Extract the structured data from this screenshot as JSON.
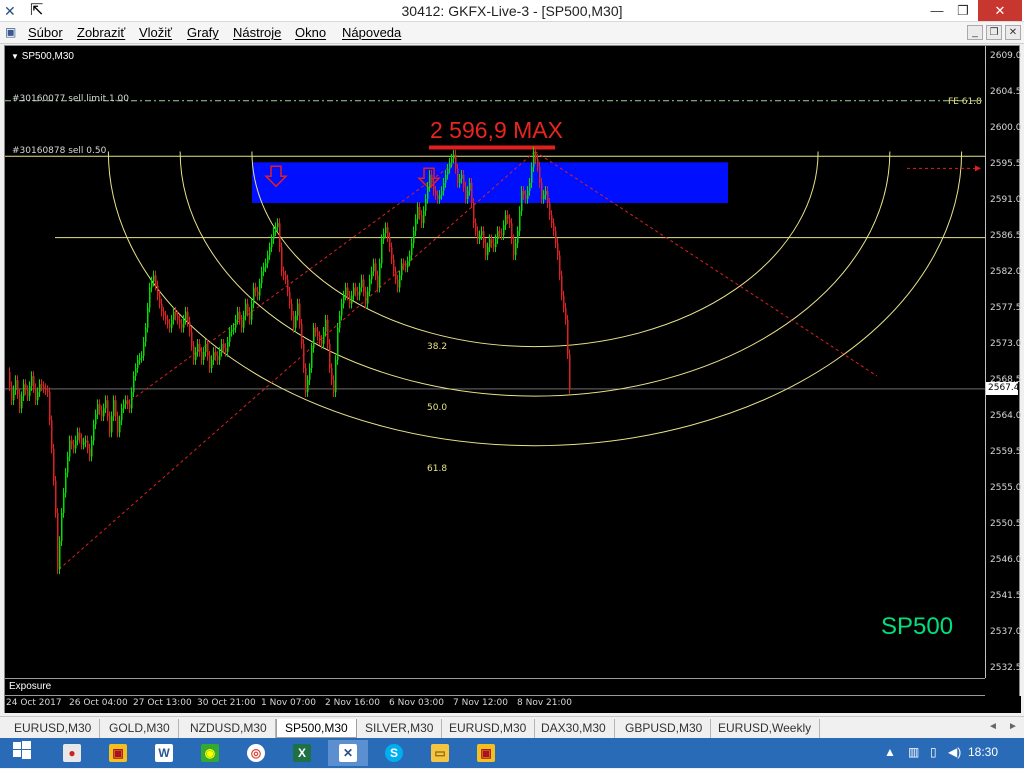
{
  "window": {
    "title": "30412: GKFX-Live-3 - [SP500,M30]",
    "minimize": "—",
    "maximize": "❐",
    "close": "✕"
  },
  "menu": {
    "items": [
      "Súbor",
      "Zobraziť",
      "Vložiť",
      "Grafy",
      "Nástroje",
      "Okno",
      "Nápoveda"
    ]
  },
  "chart": {
    "symbol_label": "SP500,M30",
    "order_sell_limit": "#30160077 sell limit 1.00",
    "order_sell": "#30160878 sell 0.50",
    "max_label": "2 596,9 MAX",
    "fe_label": "FE 61.8",
    "fib_levels": [
      "38.2",
      "50.0",
      "61.8"
    ],
    "watermark": "SP500",
    "current_price": "2567.4",
    "exposure_label": "Exposure",
    "colors": {
      "background": "#000000",
      "bull_candle": "#00e000",
      "bear_candle": "#e02020",
      "fib": "#e8e28a",
      "zone": "#0010ff",
      "trendline": "#e02020",
      "watermark": "#00e07a"
    }
  },
  "chart_data": {
    "type": "candlestick",
    "symbol": "SP500",
    "timeframe": "M30",
    "y_ticks": [
      "2609.0",
      "2604.5",
      "2600.0",
      "2595.5",
      "2591.0",
      "2586.5",
      "2582.0",
      "2577.5",
      "2573.0",
      "2568.5",
      "2564.0",
      "2559.5",
      "2555.0",
      "2550.5",
      "2546.0",
      "2541.5",
      "2537.0",
      "2532.5"
    ],
    "x_ticks": [
      "24 Oct 2017",
      "26 Oct 04:00",
      "27 Oct 13:00",
      "30 Oct 21:00",
      "1 Nov 07:00",
      "2 Nov 16:00",
      "6 Nov 03:00",
      "7 Nov 12:00",
      "8 Nov 21:00"
    ],
    "ylim": [
      2531.5,
      2610.0
    ],
    "max_price": 2596.9,
    "current_price": 2567.4,
    "fib_retracement_levels": [
      38.2,
      50.0,
      61.8
    ],
    "horizontal_levels": {
      "sell_limit": 2603.2,
      "sell": 2596.3,
      "resistance": 2586.2,
      "current": 2567.4
    },
    "path": [
      [
        0,
        2569.5
      ],
      [
        4,
        2566.0
      ],
      [
        8,
        2568.5
      ],
      [
        12,
        2565.0
      ],
      [
        16,
        2568.0
      ],
      [
        20,
        2566.5
      ],
      [
        24,
        2569.0
      ],
      [
        28,
        2566.0
      ],
      [
        32,
        2568.0
      ],
      [
        36,
        2567.5
      ],
      [
        40,
        2567.0
      ],
      [
        44,
        2560.0
      ],
      [
        48,
        2552.0
      ],
      [
        50,
        2545.0
      ],
      [
        54,
        2552.0
      ],
      [
        58,
        2557.0
      ],
      [
        62,
        2561.0
      ],
      [
        66,
        2560.0
      ],
      [
        70,
        2562.0
      ],
      [
        74,
        2560.5
      ],
      [
        78,
        2561.0
      ],
      [
        82,
        2559.0
      ],
      [
        86,
        2563.0
      ],
      [
        90,
        2565.5
      ],
      [
        94,
        2564.0
      ],
      [
        98,
        2566.0
      ],
      [
        102,
        2562.0
      ],
      [
        106,
        2566.0
      ],
      [
        110,
        2562.0
      ],
      [
        114,
        2565.0
      ],
      [
        118,
        2566.0
      ],
      [
        122,
        2565.0
      ],
      [
        126,
        2569.0
      ],
      [
        130,
        2571.0
      ],
      [
        134,
        2571.5
      ],
      [
        138,
        2575.0
      ],
      [
        142,
        2580.0
      ],
      [
        146,
        2581.5
      ],
      [
        150,
        2579.0
      ],
      [
        154,
        2577.0
      ],
      [
        158,
        2576.0
      ],
      [
        162,
        2575.0
      ],
      [
        166,
        2577.0
      ],
      [
        170,
        2576.0
      ],
      [
        174,
        2575.0
      ],
      [
        178,
        2577.0
      ],
      [
        182,
        2574.5
      ],
      [
        186,
        2571.0
      ],
      [
        190,
        2573.0
      ],
      [
        194,
        2571.0
      ],
      [
        198,
        2573.0
      ],
      [
        202,
        2570.0
      ],
      [
        206,
        2572.0
      ],
      [
        210,
        2571.0
      ],
      [
        214,
        2573.0
      ],
      [
        218,
        2572.0
      ],
      [
        222,
        2574.5
      ],
      [
        226,
        2575.0
      ],
      [
        230,
        2577.0
      ],
      [
        234,
        2575.0
      ],
      [
        238,
        2578.0
      ],
      [
        242,
        2576.0
      ],
      [
        246,
        2580.0
      ],
      [
        250,
        2579.0
      ],
      [
        254,
        2582.0
      ],
      [
        258,
        2583.0
      ],
      [
        262,
        2585.0
      ],
      [
        266,
        2587.0
      ],
      [
        270,
        2588.0
      ],
      [
        274,
        2582.0
      ],
      [
        278,
        2581.0
      ],
      [
        282,
        2578.0
      ],
      [
        286,
        2575.0
      ],
      [
        290,
        2578.0
      ],
      [
        294,
        2573.0
      ],
      [
        298,
        2567.0
      ],
      [
        302,
        2570.0
      ],
      [
        306,
        2575.0
      ],
      [
        310,
        2574.0
      ],
      [
        314,
        2573.0
      ],
      [
        318,
        2576.0
      ],
      [
        322,
        2570.0
      ],
      [
        326,
        2567.0
      ],
      [
        330,
        2575.0
      ],
      [
        334,
        2578.0
      ],
      [
        338,
        2580.0
      ],
      [
        342,
        2578.0
      ],
      [
        346,
        2580.0
      ],
      [
        350,
        2579.0
      ],
      [
        354,
        2581.0
      ],
      [
        358,
        2578.0
      ],
      [
        362,
        2581.0
      ],
      [
        366,
        2583.0
      ],
      [
        370,
        2580.0
      ],
      [
        374,
        2586.0
      ],
      [
        378,
        2587.5
      ],
      [
        382,
        2585.0
      ],
      [
        386,
        2582.0
      ],
      [
        390,
        2580.0
      ],
      [
        394,
        2583.0
      ],
      [
        398,
        2582.5
      ],
      [
        402,
        2584.0
      ],
      [
        406,
        2587.0
      ],
      [
        410,
        2590.0
      ],
      [
        414,
        2588.0
      ],
      [
        418,
        2591.0
      ],
      [
        422,
        2594.0
      ],
      [
        426,
        2592.0
      ],
      [
        430,
        2591.0
      ],
      [
        434,
        2592.0
      ],
      [
        438,
        2594.0
      ],
      [
        442,
        2595.5
      ],
      [
        446,
        2596.5
      ],
      [
        450,
        2593.0
      ],
      [
        454,
        2594.0
      ],
      [
        458,
        2591.0
      ],
      [
        462,
        2593.0
      ],
      [
        466,
        2588.0
      ],
      [
        470,
        2586.0
      ],
      [
        474,
        2587.0
      ],
      [
        478,
        2584.0
      ],
      [
        482,
        2586.0
      ],
      [
        486,
        2585.0
      ],
      [
        490,
        2587.0
      ],
      [
        494,
        2586.5
      ],
      [
        498,
        2589.0
      ],
      [
        502,
        2588.0
      ],
      [
        506,
        2584.0
      ],
      [
        510,
        2587.0
      ],
      [
        514,
        2592.0
      ],
      [
        518,
        2591.0
      ],
      [
        522,
        2593.0
      ],
      [
        526,
        2596.9
      ],
      [
        530,
        2595.0
      ],
      [
        534,
        2591.0
      ],
      [
        538,
        2592.0
      ],
      [
        542,
        2589.0
      ],
      [
        546,
        2587.0
      ],
      [
        550,
        2584.0
      ],
      [
        554,
        2579.0
      ],
      [
        558,
        2576.0
      ],
      [
        562,
        2567.4
      ]
    ]
  },
  "price_axis": [
    "2609.0",
    "2604.5",
    "2600.0",
    "2595.5",
    "2591.0",
    "2586.5",
    "2582.0",
    "2577.5",
    "2573.0",
    "2568.5",
    "2564.0",
    "2559.5",
    "2555.0",
    "2550.5",
    "2546.0",
    "2541.5",
    "2537.0",
    "2532.5"
  ],
  "time_axis": [
    "24 Oct 2017",
    "26 Oct 04:00",
    "27 Oct 13:00",
    "30 Oct 21:00",
    "1 Nov 07:00",
    "2 Nov 16:00",
    "6 Nov 03:00",
    "7 Nov 12:00",
    "8 Nov 21:00"
  ],
  "tabs": [
    "EURUSD,M30",
    "GOLD,M30",
    "NZDUSD,M30",
    "SP500,M30",
    "SILVER,M30",
    "EURUSD,M30",
    "DAX30,M30",
    "GBPUSD,M30",
    "EURUSD,Weekly"
  ],
  "active_tab": "SP500,M30",
  "taskbar": {
    "clock": "18:30",
    "apps": [
      "windows-start",
      "paint",
      "metatrader",
      "word",
      "mt4-green",
      "chrome",
      "excel",
      "mt4-active",
      "skype",
      "file-explorer",
      "metatrader-2"
    ]
  }
}
